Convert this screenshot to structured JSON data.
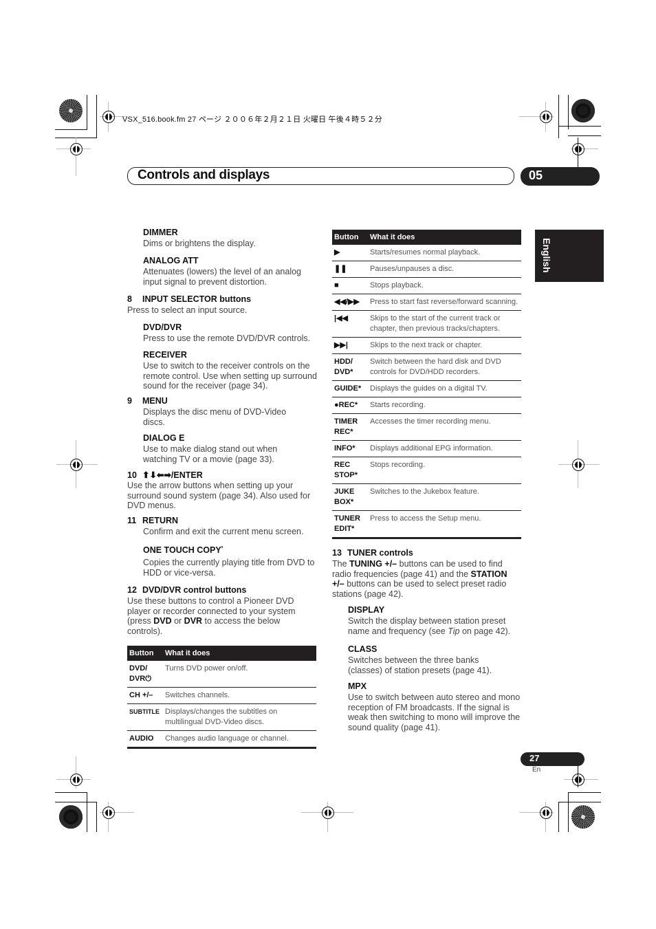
{
  "file_info": "VSX_516.book.fm  27 ページ  ２００６年２月２１日  火曜日  午後４時５２分",
  "header": {
    "title": "Controls and displays",
    "chapter": "05"
  },
  "language_tab": "English",
  "left_column": {
    "dimmer": {
      "title": "DIMMER",
      "text": "Dims or brightens the display."
    },
    "analog_att": {
      "title": "ANALOG ATT",
      "text": "Attenuates (lowers) the level of an analog input signal to prevent distortion."
    },
    "item8": {
      "num": "8",
      "title": "INPUT SELECTOR buttons",
      "text": "Press to select an input source."
    },
    "dvd_dvr": {
      "title": "DVD/DVR",
      "text": "Press to use the remote DVD/DVR controls."
    },
    "receiver": {
      "title": "RECEIVER",
      "text": "Use to switch to the receiver controls on the remote control. Use when setting up surround sound for the receiver (page 34)."
    },
    "item9": {
      "num": "9",
      "title": "MENU",
      "text": "Displays the disc menu of DVD-Video discs."
    },
    "dialog_e": {
      "title": "DIALOG E",
      "text": "Use to make dialog stand out when watching TV or a movie (page 33)."
    },
    "item10": {
      "num": "10",
      "title": "⬆⬇⬅➡/ENTER",
      "text": "Use the arrow buttons when setting up your surround sound system (page 34). Also used for DVD menus."
    },
    "item11": {
      "num": "11",
      "title": "RETURN",
      "text": "Confirm and exit the current menu screen."
    },
    "one_touch": {
      "title": "ONE TOUCH COPY",
      "mark": "*",
      "text": "Copies the currently playing title from DVD to HDD or vice-versa."
    },
    "item12": {
      "num": "12",
      "title": "DVD/DVR control buttons",
      "text_a": "Use these buttons to control a Pioneer DVD player or recorder connected to your system (press ",
      "bold1": "DVD",
      "or": " or ",
      "bold2": "DVR",
      "text_b": " to access the below controls)."
    },
    "table": {
      "headers": [
        "Button",
        "What it does"
      ],
      "rows": [
        {
          "button": "DVD/ DVR⏻",
          "desc": "Turns DVD power on/off."
        },
        {
          "button": "CH +/–",
          "desc": "Switches channels."
        },
        {
          "button": "SUBTITLE",
          "desc": "Displays/changes the subtitles on multilingual DVD-Video discs."
        },
        {
          "button": "AUDIO",
          "desc": "Changes audio language or channel."
        }
      ]
    }
  },
  "right_column": {
    "table": {
      "headers": [
        "Button",
        "What it does"
      ],
      "rows": [
        {
          "button": "▶",
          "desc": "Starts/resumes normal playback."
        },
        {
          "button": "❚❚",
          "desc": "Pauses/unpauses a disc."
        },
        {
          "button": "■",
          "desc": "Stops playback."
        },
        {
          "button": "◀◀/▶▶",
          "desc": "Press to start fast reverse/forward scanning."
        },
        {
          "button": "|◀◀",
          "desc": "Skips to the start of the current track or chapter, then previous tracks/chapters."
        },
        {
          "button": "▶▶|",
          "desc": "Skips to the next track or chapter."
        },
        {
          "button": "HDD/ DVD*",
          "desc": "Switch between the hard disk and DVD controls for DVD/HDD recorders."
        },
        {
          "button": "GUIDE*",
          "desc": "Displays the guides on a digital TV."
        },
        {
          "button": "●REC*",
          "desc": "Starts recording."
        },
        {
          "button": "TIMER REC*",
          "desc": "Accesses the timer recording menu."
        },
        {
          "button": "INFO*",
          "desc": "Displays additional EPG information."
        },
        {
          "button": "REC STOP*",
          "desc": "Stops recording."
        },
        {
          "button": "JUKE BOX*",
          "desc": "Switches to the Jukebox feature."
        },
        {
          "button": "TUNER EDIT*",
          "desc": "Press to access the Setup menu."
        }
      ]
    },
    "item13": {
      "num": "13",
      "title": "TUNER controls",
      "t1": "The ",
      "b1": "TUNING +/–",
      "t2": " buttons can be used to find radio frequencies (page 41) and the ",
      "b2": "STATION +/–",
      "t3": " buttons can be used to select preset radio stations (page 42)."
    },
    "display": {
      "title": "DISPLAY",
      "t1": "Switch the display between station preset name and frequency (see ",
      "tip": "Tip",
      "t2": " on page 42)."
    },
    "class": {
      "title": "CLASS",
      "text": "Switches between the three banks (classes) of station presets (page 41)."
    },
    "mpx": {
      "title": "MPX",
      "text": "Use to switch between auto stereo and mono reception of FM broadcasts. If the signal is weak then switching to mono will improve the sound quality (page 41)."
    }
  },
  "footer": {
    "page": "27",
    "lang": "En"
  }
}
